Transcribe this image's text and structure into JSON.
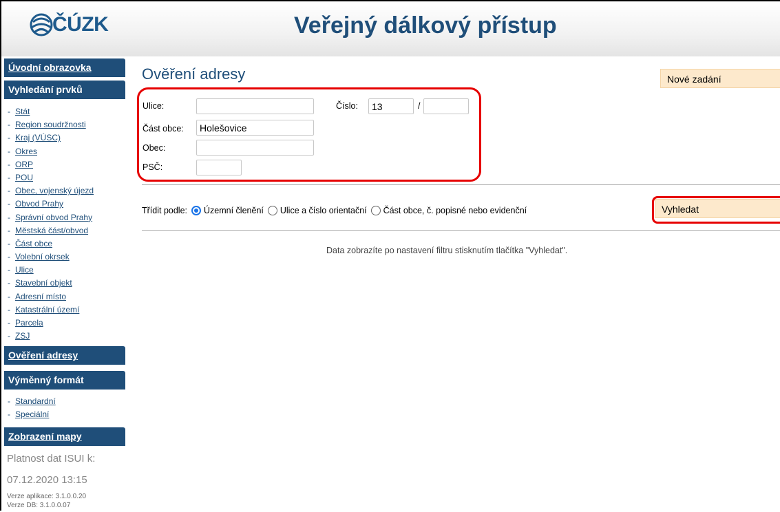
{
  "header": {
    "logo_text": "ČÚZK",
    "title": "Veřejný dálkový přístup"
  },
  "sidebar": {
    "uvod": "Úvodní obrazovka",
    "vyhledani": "Vyhledání prvků",
    "vyhledani_items": [
      "Stát",
      "Region soudržnosti",
      "Kraj (VÚSC)",
      "Okres",
      "ORP",
      "POU",
      "Obec, vojenský újezd",
      "Obvod Prahy",
      "Správní obvod Prahy",
      "Městská část/obvod",
      "Část obce",
      "Volební okrsek",
      "Ulice",
      "Stavební objekt",
      "Adresní místo",
      "Katastrální území",
      "Parcela",
      "ZSJ"
    ],
    "overeni": "Ověření adresy",
    "vymenny": "Výměnný formát",
    "vymenny_items": [
      "Standardní",
      "Speciální"
    ],
    "mapa": "Zobrazení mapy",
    "validity_label": "Platnost dat ISUI k:",
    "validity_date": "07.12.2020 13:15",
    "app_version": "Verze aplikace: 3.1.0.0.20",
    "db_version": "Verze DB: 3.1.0.0.07"
  },
  "main": {
    "title": "Ověření adresy",
    "new_button": "Nové zadání",
    "form": {
      "ulice_label": "Ulice:",
      "ulice_value": "",
      "cast_obce_label": "Část obce:",
      "cast_obce_value": "Holešovice",
      "obec_label": "Obec:",
      "obec_value": "",
      "psc_label": "PSČ:",
      "psc_value": "",
      "cislo_label": "Číslo:",
      "cislo_value": "13",
      "slash": "/",
      "cislo_orient_value": ""
    },
    "sort": {
      "label": "Třídit podle:",
      "options": [
        "Územní členění",
        "Ulice a číslo orientační",
        "Část obce, č. popisné nebo evidenční"
      ],
      "selected": "Územní členění"
    },
    "search_button": "Vyhledat",
    "hint": "Data zobrazíte po nastavení filtru stisknutím tlačítka \"Vyhledat\".",
    "highlight_color": "#e60000",
    "accent_color": "#1f4e79"
  }
}
